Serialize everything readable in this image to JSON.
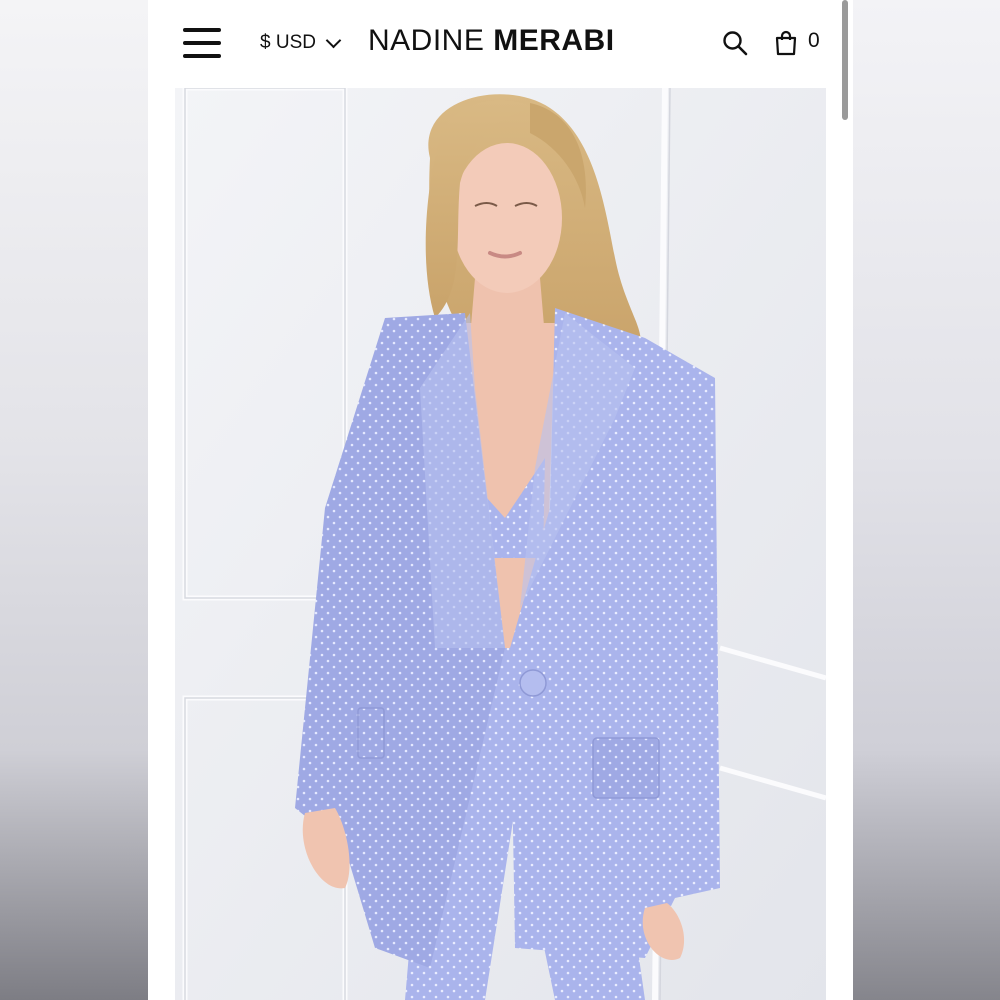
{
  "header": {
    "menu_icon": "hamburger-menu-icon",
    "currency_label": "$ USD",
    "currency_icon": "chevron-down-icon",
    "brand_light": "NADINE",
    "brand_bold": "MERABI",
    "search_icon": "search-icon",
    "cart_icon": "shopping-bag-icon",
    "cart_count": "0"
  },
  "product": {
    "image_subject": "lavender-crystal-embellished-blazer"
  },
  "colors": {
    "suit": "#aab4ec",
    "background_wall": "#eef0f3"
  }
}
